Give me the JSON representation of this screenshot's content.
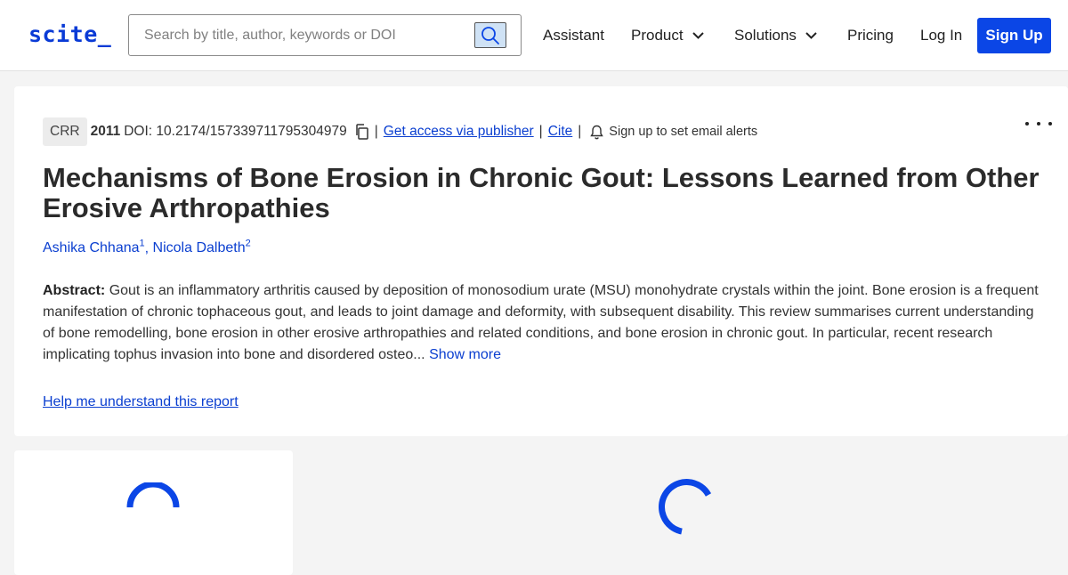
{
  "header": {
    "logo": "scite_",
    "search": {
      "placeholder": "Search by title, author, keywords or DOI",
      "value": ""
    },
    "nav": [
      {
        "label": "Assistant"
      },
      {
        "label": "Product"
      },
      {
        "label": "Solutions"
      },
      {
        "label": "Pricing"
      },
      {
        "label": "Log In"
      }
    ],
    "signup_label": "Sign Up"
  },
  "report": {
    "journal_badge": "CRR",
    "year": "2011",
    "doi": "DOI: 10.2174/157339711795304979",
    "access_link": "Get access via publisher",
    "cite_link": "Cite",
    "alerts_text": "Sign up to set email alerts",
    "title": "Mechanisms of Bone Erosion in Chronic Gout: Lessons Learned from Other Erosive Arthropathies",
    "authors": [
      {
        "name": "Ashika Chhana",
        "sup": "1"
      },
      {
        "name": "Nicola Dalbeth",
        "sup": "2"
      }
    ],
    "abstract_label": "Abstract:",
    "abstract_text": "Gout is an inflammatory arthritis caused by deposition of monosodium urate (MSU) monohydrate crystals within the joint. Bone erosion is a frequent manifestation of chronic tophaceous gout, and leads to joint damage and deformity, with subsequent disability. This review summarises current understanding of bone remodelling, bone erosion in other erosive arthropathies and related conditions, and bone erosion in chronic gout. In particular, recent research implicating tophus invasion into bone and disordered osteo...",
    "show_more": "Show more",
    "help_link": "Help me understand this report"
  },
  "colors": {
    "brand": "#0b46e6",
    "link": "#0b3fd0",
    "background": "#f4f4f4"
  },
  "icons": [
    "search-icon",
    "chevron-down-icon",
    "copy-icon",
    "bell-icon",
    "more-icon",
    "loading-spinner"
  ]
}
